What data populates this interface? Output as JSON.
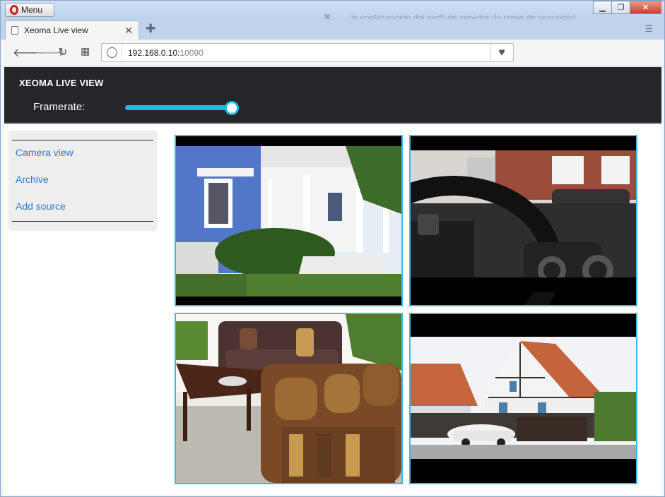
{
  "browser": {
    "menu_label": "Menu",
    "tab_title": "Xeoma Live view",
    "background_tab_text": "la configuración del perfil de servidor de copia de seguridad",
    "url_host": "192.168.0.10:",
    "url_port": "10090",
    "window_controls": [
      "minimize",
      "maximize",
      "close"
    ]
  },
  "app": {
    "title": "XEOMA LIVE VIEW",
    "framerate_label": "Framerate:",
    "framerate_level": 0.98,
    "accent_color": "#24b7e6"
  },
  "sidebar": {
    "items": [
      {
        "label": "Camera view"
      },
      {
        "label": "Archive"
      },
      {
        "label": "Add source"
      }
    ]
  },
  "cameras": [
    {
      "scene": "house-porch"
    },
    {
      "scene": "car-dashboard"
    },
    {
      "scene": "living-room"
    },
    {
      "scene": "timber-house"
    }
  ]
}
